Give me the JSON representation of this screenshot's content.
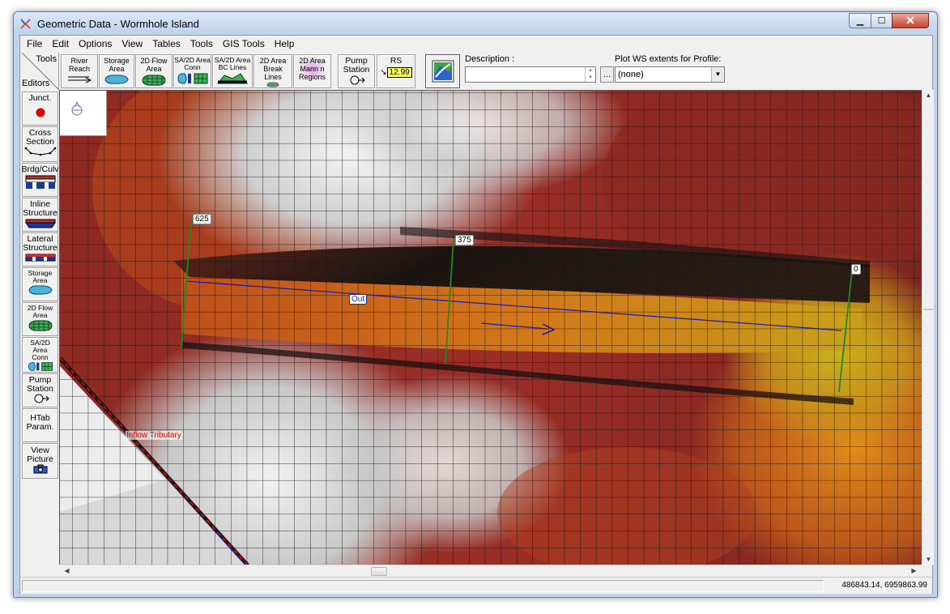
{
  "window": {
    "title": "Geometric Data - Wormhole Island"
  },
  "menu": [
    "File",
    "Edit",
    "Options",
    "View",
    "Tables",
    "Tools",
    "GIS Tools",
    "Help"
  ],
  "toolbar": {
    "tools_label": "Tools",
    "editors_label": "Editors",
    "buttons": [
      {
        "label": "River\nReach",
        "icon": "river-reach-icon"
      },
      {
        "label": "Storage\nArea",
        "icon": "storage-area-icon"
      },
      {
        "label": "2D Flow\nArea",
        "icon": "2d-flow-area-icon"
      },
      {
        "label": "SA/2D Area\nConn",
        "icon": "sa-2d-conn-icon"
      },
      {
        "label": "SA/2D Area\nBC Lines",
        "icon": "bc-lines-icon"
      },
      {
        "label": "2D Area\nBreak Lines",
        "icon": "break-lines-icon"
      },
      {
        "label": "2D Area\nMann n\nRegions",
        "icon": "mann-n-regions-icon"
      },
      {
        "label": "Pump\nStation",
        "icon": "pump-station-icon"
      },
      {
        "label": "RS",
        "icon": "rs-icon",
        "value": "12.99"
      }
    ],
    "map_background_icon": "map-layers-icon",
    "description_label": "Description :",
    "description_value": "",
    "description_more": "...",
    "plot_ws_label": "Plot WS extents for Profile:",
    "plot_ws_value": "(none)"
  },
  "sidebar": [
    {
      "label": "Junct.",
      "icon": "junction-icon"
    },
    {
      "label": "Cross\nSection",
      "icon": "cross-section-icon"
    },
    {
      "label": "Brdg/Culv",
      "icon": "bridge-culvert-icon"
    },
    {
      "label": "Inline\nStructure",
      "icon": "inline-structure-icon"
    },
    {
      "label": "Lateral\nStructure",
      "icon": "lateral-structure-icon"
    },
    {
      "label": "Storage\nArea",
      "icon": "storage-area-icon"
    },
    {
      "label": "2D Flow\nArea",
      "icon": "2d-flow-area-icon"
    },
    {
      "label": "SA/2D Area\nConn",
      "icon": "sa-2d-conn-icon"
    },
    {
      "label": "Pump\nStation",
      "icon": "pump-station-icon"
    },
    {
      "label": "HTab\nParam.",
      "icon": ""
    },
    {
      "label": "View\nPicture",
      "icon": "camera-icon"
    }
  ],
  "map": {
    "cross_sections": [
      "625",
      "375",
      "0"
    ],
    "reach_label": "Out",
    "tributary_label": "Inflow Tributary",
    "colors": {
      "reach": "#1a1aa8",
      "cross_section": "#1f8a1f",
      "tributary": "#e00000",
      "grid": "#111111"
    }
  },
  "status": {
    "coords": "486843.14, 6959863.99"
  }
}
